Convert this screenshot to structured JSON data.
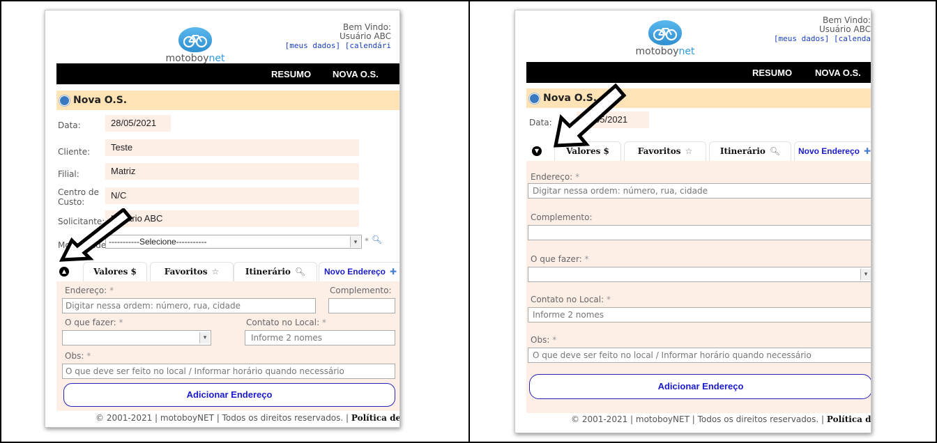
{
  "brand": {
    "name": "motoboy",
    "accent": "net"
  },
  "header": {
    "welcome": "Bem Vindo:",
    "user": "Usuário ABC",
    "links": "[meus dados]  [calendári"
  },
  "header_right": {
    "welcome": "Bem Vindo:",
    "user": "Usuário ABC",
    "links": "[meus dados]  [calenda"
  },
  "nav": {
    "resumo": "RESUMO",
    "nova": "NOVA O.S."
  },
  "title": "Nova O.S.",
  "form": {
    "data_label": "Data:",
    "data_value": "28/05/2021",
    "cliente_label": "Cliente:",
    "cliente_value": "Teste",
    "filial_label": "Filial:",
    "filial_value": "Matriz",
    "centro_label": "Centro de Custo:",
    "centro_value": "N/C",
    "solicitante_label": "Solicitante:",
    "solicitante_value": "Usuário ABC",
    "modalidade_label": "Modalidade:",
    "modalidade_value": "-----------Selecione-----------"
  },
  "tabs": {
    "valores": "Valores $",
    "favoritos": "Favoritos",
    "itinerario": "Itinerário",
    "novo": "Novo Endereço"
  },
  "address": {
    "endereco_label": "Endereço:",
    "endereco_placeholder": "Digitar nessa ordem: número, rua, cidade",
    "complemento_label": "Complemento:",
    "oquefazer_label": "O que fazer:",
    "contato_label": "Contato no Local:",
    "contato_placeholder": "Informe 2 nomes",
    "obs_label": "Obs:",
    "obs_placeholder": "O que deve ser feito no local / Informar horário quando necessário",
    "required_mark": "*",
    "add_button": "Adicionar Endereço"
  },
  "footer": {
    "text": "© 2001-2021 | motoboyNET | Todos os direitos reservados. |",
    "policy": "Política de Priv",
    "policy_right": "Política de Pri"
  },
  "colors": {
    "nav_bg": "#000000",
    "title_bg": "#fde3b6",
    "panel_bg": "#fdeee6",
    "link_blue": "#1a1acc",
    "brand_blue": "#2f9be0"
  },
  "icons": [
    "bicycle-logo-icon",
    "circle-arrow-icon",
    "search-icon",
    "star-icon",
    "plus-icon",
    "chevron-up-icon",
    "chevron-down-icon",
    "pointer-arrow-icon"
  ]
}
